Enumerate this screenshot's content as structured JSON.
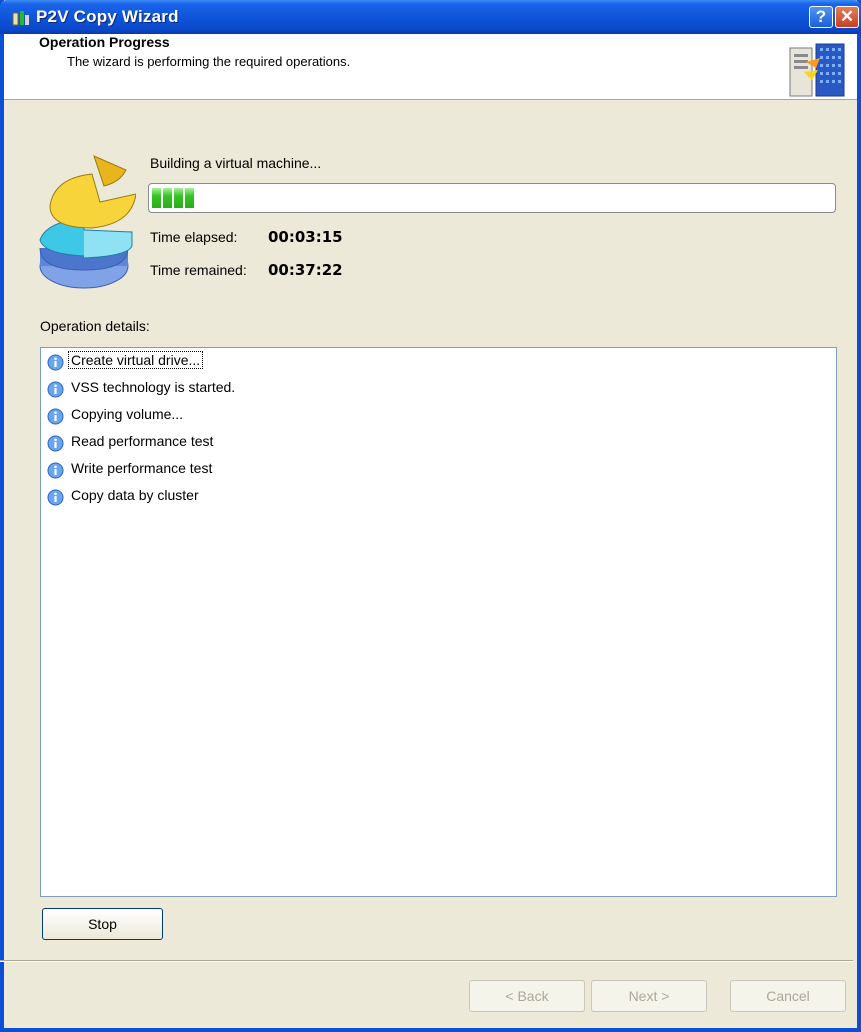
{
  "window": {
    "title": "P2V Copy Wizard",
    "help_glyph": "?",
    "close_glyph": "✕"
  },
  "header": {
    "title": "Operation Progress",
    "subtitle": "The wizard is performing the required operations."
  },
  "progress": {
    "status": "Building a virtual machine...",
    "fraction": 0.07,
    "time_elapsed_label": "Time elapsed:",
    "time_elapsed": "00:03:15",
    "time_remained_label": "Time remained:",
    "time_remained": "00:37:22"
  },
  "details": {
    "label": "Operation details:",
    "items": [
      {
        "text": "Create virtual drive...",
        "icon": "info-icon"
      },
      {
        "text": "VSS technology is started.",
        "icon": "info-icon"
      },
      {
        "text": "Copying volume...",
        "icon": "info-icon"
      },
      {
        "text": "Read performance test",
        "icon": "info-icon"
      },
      {
        "text": "Write performance test",
        "icon": "info-icon"
      },
      {
        "text": "Copy data by cluster",
        "icon": "info-icon"
      }
    ]
  },
  "buttons": {
    "stop": "Stop",
    "back": "< Back",
    "next": "Next >",
    "cancel": "Cancel"
  },
  "colors": {
    "titlebar": "#0f55db",
    "progress_fill": "#35c424",
    "dialog_bg": "#ece9d8"
  }
}
